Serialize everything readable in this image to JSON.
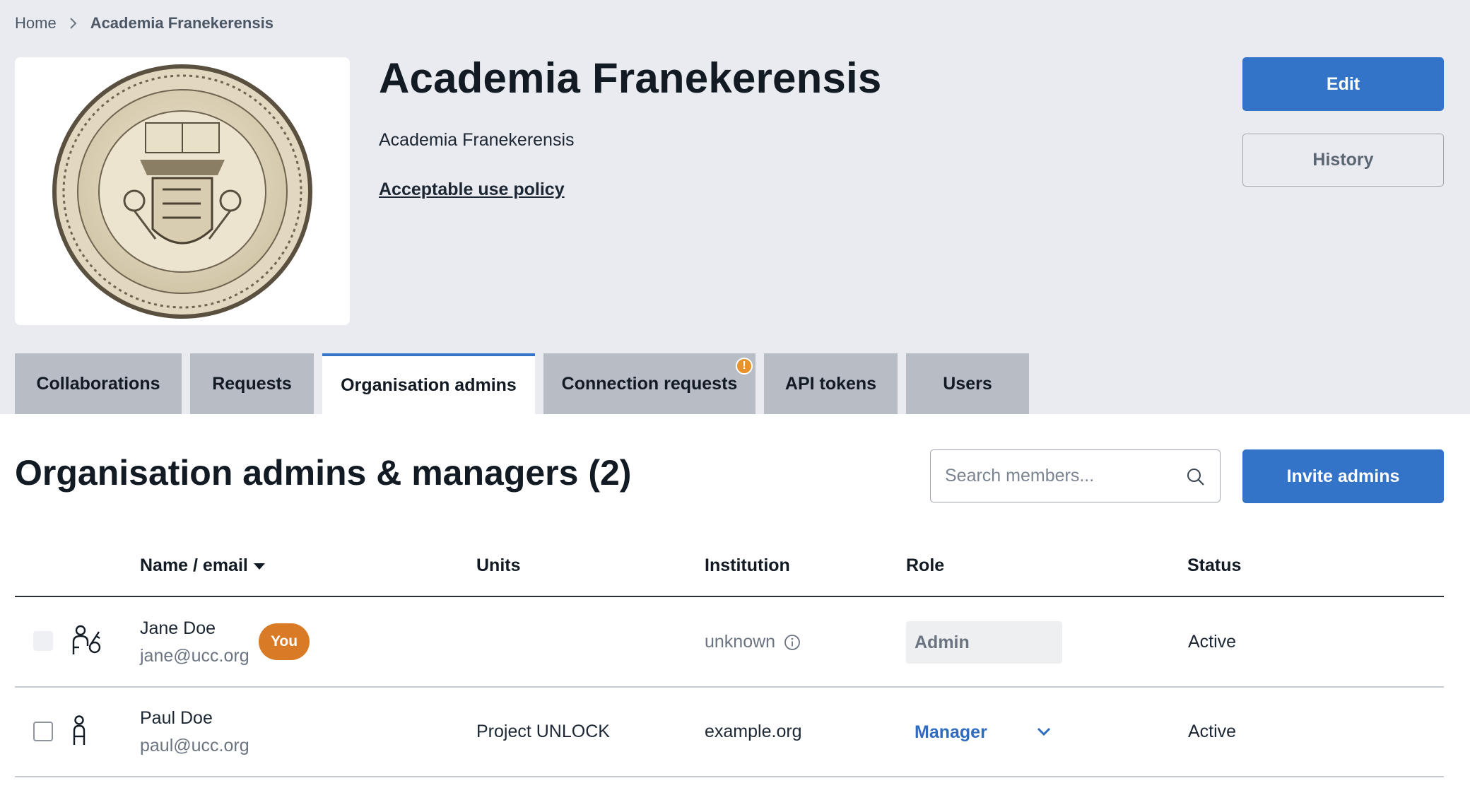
{
  "breadcrumb": {
    "home": "Home",
    "current": "Academia Franekerensis"
  },
  "organisation": {
    "title": "Academia Franekerensis",
    "subtitle": "Academia Franekerensis",
    "aup_link": "Acceptable use policy"
  },
  "actions": {
    "edit": "Edit",
    "history": "History"
  },
  "tabs": [
    {
      "label": "Collaborations",
      "active": false
    },
    {
      "label": "Requests",
      "active": false
    },
    {
      "label": "Organisation admins",
      "active": true
    },
    {
      "label": "Connection requests",
      "active": false,
      "notification": "!"
    },
    {
      "label": "API tokens",
      "active": false
    },
    {
      "label": "Users",
      "active": false
    }
  ],
  "section": {
    "title": "Organisation admins & managers (2)",
    "search_placeholder": "Search members...",
    "invite": "Invite admins"
  },
  "table": {
    "headers": {
      "name": "Name / email",
      "units": "Units",
      "institution": "Institution",
      "role": "Role",
      "status": "Status"
    },
    "rows": [
      {
        "name": "Jane Doe",
        "email": "jane@ucc.org",
        "badge": "You",
        "units": "",
        "institution": "unknown",
        "role": "Admin",
        "status": "Active"
      },
      {
        "name": "Paul Doe",
        "email": "paul@ucc.org",
        "units": "Project UNLOCK",
        "institution": "example.org",
        "role": "Manager",
        "status": "Active"
      }
    ]
  },
  "colors": {
    "primary": "#3374c9",
    "badge": "#d97b26",
    "notification": "#e8922a",
    "top_background": "#eaebf1"
  }
}
